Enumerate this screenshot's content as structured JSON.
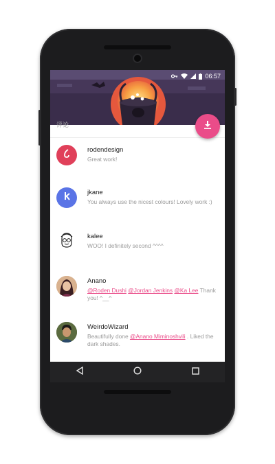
{
  "status": {
    "time": "06:57"
  },
  "header": {
    "section_label": "评论"
  },
  "fab": {
    "icon": "download-icon"
  },
  "comments": [
    {
      "author": "rodendesign",
      "text": "Great work!",
      "avatar_color": "#e0405a",
      "avatar_icon": "rodendesign-logo"
    },
    {
      "author": "jkane",
      "text": "You always use the nicest colours! Lovely work :)",
      "avatar_color": "#5a74e6",
      "avatar_icon": "jkane-logo"
    },
    {
      "author": "kalee",
      "text": "WOO! I definitely second ^^^^",
      "avatar_color": "#ffffff",
      "avatar_icon": "sketch-face"
    },
    {
      "author": "Anano",
      "mention1": "@Roden Dushi",
      "mention2": "@Jordan Jenkins",
      "mention3": "@Ka Lee",
      "text_after": " Thank you! ^__^",
      "avatar_color": "#8a4b5b"
    },
    {
      "author": "WeirdoWizard",
      "text_before": "Beautifully done ",
      "mention1": "@Anano Miminoshvili",
      "text_after": " . Liked the dark shades.",
      "avatar_color": "#4b5a3c"
    }
  ],
  "navbar": {
    "back": "back-icon",
    "home": "home-icon",
    "recents": "recents-icon"
  }
}
